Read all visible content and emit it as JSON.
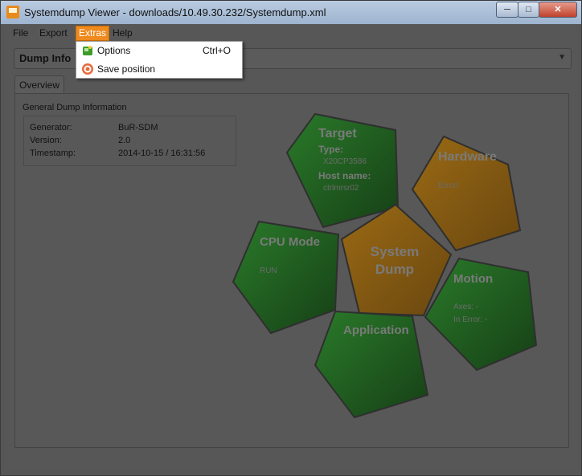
{
  "window": {
    "title": "Systemdump Viewer - downloads/10.49.30.232/Systemdump.xml"
  },
  "menubar": {
    "items": [
      "File",
      "Export",
      "Extras",
      "Help"
    ]
  },
  "extras_menu": {
    "items": [
      {
        "label": "Options",
        "shortcut": "Ctrl+O",
        "icon": "options-icon"
      },
      {
        "label": "Save position",
        "shortcut": "",
        "icon": "target-icon"
      }
    ]
  },
  "combo": {
    "selected": "Dump Info"
  },
  "tabs": [
    "Overview"
  ],
  "general_info": {
    "title": "General Dump Information",
    "rows": [
      {
        "key": "Generator:",
        "value": "BuR-SDM"
      },
      {
        "key": "Version:",
        "value": "2.0"
      },
      {
        "key": "Timestamp:",
        "value": "2014-10-15 / 16:31:56"
      }
    ]
  },
  "diagram": {
    "center": {
      "line1": "System",
      "line2": "Dump"
    },
    "target": {
      "label": "Target",
      "type_label": "Type:",
      "type_value": "X20CP3586",
      "host_label": "Host name:",
      "host_value": "ctrlmrsr02"
    },
    "hardware": {
      "label": "Hardware",
      "status": "Error!"
    },
    "cpu_mode": {
      "label": "CPU Mode",
      "value": "RUN"
    },
    "motion": {
      "label": "Motion",
      "axes": "Axes: -",
      "in_error": "In Error: -"
    },
    "application": {
      "label": "Application"
    },
    "colors": {
      "green": "#1f6e1f",
      "orange": "#8d5f12"
    }
  }
}
